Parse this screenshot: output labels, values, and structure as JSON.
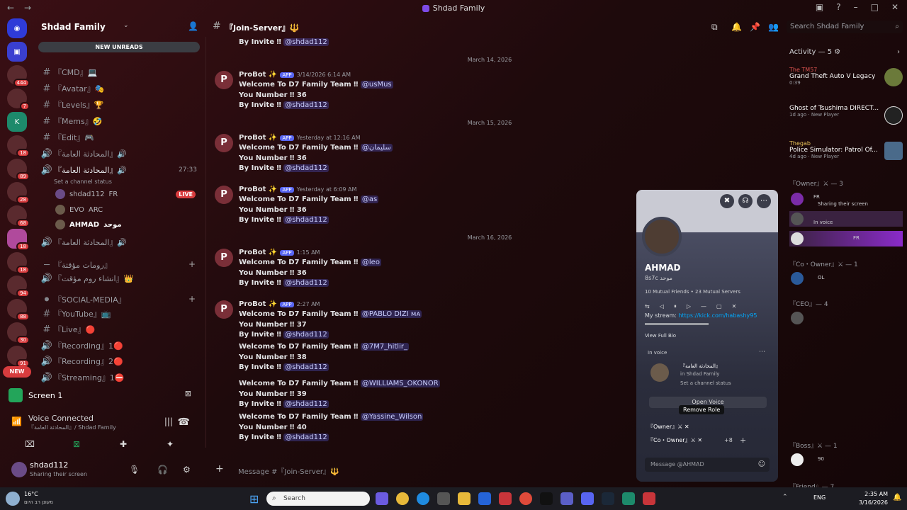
{
  "window": {
    "title": "Shdad Family",
    "back": "←",
    "forward": "→"
  },
  "server": {
    "name": "Shdad Family",
    "new_unreads": "NEW UNREADS"
  },
  "rail": {
    "badges": [
      "444",
      "7",
      "18",
      "18",
      "89",
      "28",
      "68",
      "18",
      "94",
      "88",
      "30",
      "91"
    ],
    "new_label": "NEW"
  },
  "channels": [
    {
      "name": "『CMD』💻"
    },
    {
      "name": "『Avatar』🎭"
    },
    {
      "name": "『Levels』🏆"
    },
    {
      "name": "『Mems』🤣"
    },
    {
      "name": "『Edit』🎮"
    },
    {
      "name": "『المحادثة العامة』🔊"
    },
    {
      "name": "『المحادثة العامة』🔊",
      "time": "27:33"
    },
    {
      "name": "『المحادثة العامة』🔊"
    },
    {
      "name": "『انشاء روم مؤقت』👑"
    },
    {
      "name": "『YouTube』📺"
    },
    {
      "name": "『Live』🔴"
    },
    {
      "name": "『Recording』1🔴"
    },
    {
      "name": "『Recording』2🔴"
    },
    {
      "name": "『Streaming』1⛔"
    }
  ],
  "voice_users": [
    {
      "name": "shdad112",
      "tag": "FR",
      "live": "LIVE"
    },
    {
      "name": "EVO",
      "tag": "ARC"
    },
    {
      "name": "AHMAD",
      "tag": "موحد"
    }
  ],
  "channel_status": "Set a channel status",
  "category_rooms": "『رومات مؤقتة』",
  "category_social": "『SOCIAL-MEDIA』",
  "screen_panel": {
    "label": "Screen 1"
  },
  "voice_panel": {
    "status": "Voice Connected",
    "channel": "『المحادثة العامة』/ Shdad Family"
  },
  "user_panel": {
    "name": "shdad112",
    "status": "Sharing their screen"
  },
  "chat": {
    "channel": "『Join-Server』🔱",
    "input_placeholder": "Message #『Join-Server』🔱",
    "search_placeholder": "Search Shdad Family",
    "welcome": "Welcome To D7 Family Team ‼",
    "you_number": "You Number ‼",
    "by_invite": "By Invite ‼",
    "inviter": "@shdad112",
    "author": "ProBot ✨",
    "app_tag": "APP",
    "dates": [
      "March 14, 2026",
      "March 15, 2026",
      "March 16, 2026"
    ],
    "messages": [
      {
        "stamp": "3/14/2026 6:14 AM",
        "mention": "@usMus",
        "number": "36"
      },
      {
        "stamp": "Yesterday at 12:16 AM",
        "mention": "@سليمان",
        "number": "36"
      },
      {
        "stamp": "Yesterday at 6:09 AM",
        "mention": "@as",
        "number": "36"
      },
      {
        "stamp": "1:15 AM",
        "mention": "@leo",
        "number": "36"
      },
      {
        "stamp": "2:27 AM",
        "mention": "@PABLO DIZI ᴍᴀ",
        "number": "37"
      },
      {
        "mention": "@7M7_hitlir_",
        "number": "38"
      },
      {
        "mention": "@WILLIAMS_OKONOR",
        "number": "39"
      },
      {
        "mention": "@Yassine_Wilson",
        "number": "40"
      }
    ]
  },
  "activity": {
    "title": "Activity — 5 ⚙",
    "items": [
      {
        "user": "The TM57",
        "game": "Grand Theft Auto V Legacy",
        "meta": "0:39"
      },
      {
        "user": "",
        "game": "Ghost of Tsushima DIRECT...",
        "meta": "1d ago · New Player"
      },
      {
        "user": "Thegab",
        "game": "Police Simulator: Patrol Of...",
        "meta": "4d ago · New Player"
      }
    ],
    "roles": [
      {
        "label": "『Owner』⚔ — 3"
      },
      {
        "label": "『Co・Owner』⚔ — 1"
      },
      {
        "label": "『CEO』— 4"
      },
      {
        "label": "『Boss』⚔ — 1"
      },
      {
        "label": "『Friend』— 7"
      }
    ],
    "member_texts": [
      "FR",
      "Sharing their screen",
      "In voice",
      "FR",
      "OL",
      "90"
    ]
  },
  "popout": {
    "name": "AHMAD",
    "tag": "8s7c",
    "tag_badge": "موحد",
    "mutual": "10 Mutual Friends • 23 Mutual Servers",
    "stream_label": "My stream:",
    "stream_url": "https://kick.com/habashy95",
    "view_full_bio": "View Full Bio",
    "in_voice": "In voice",
    "vc_name": "『المحادثة العامة』",
    "vc_server": "in Shdad Family",
    "vc_status": "Set a channel status",
    "open_voice": "Open Voice",
    "tooltip": "Remove Role",
    "roles": [
      "『Owner』⚔",
      "『Co・Owner』⚔"
    ],
    "roles_more": "+8",
    "message_placeholder": "Message @AHMAD"
  },
  "taskbar": {
    "temp": "16°C",
    "weather": "מעונן רב היום",
    "search": "Search",
    "lang": "ENG",
    "time": "2:35 AM",
    "date": "3/16/2026"
  }
}
